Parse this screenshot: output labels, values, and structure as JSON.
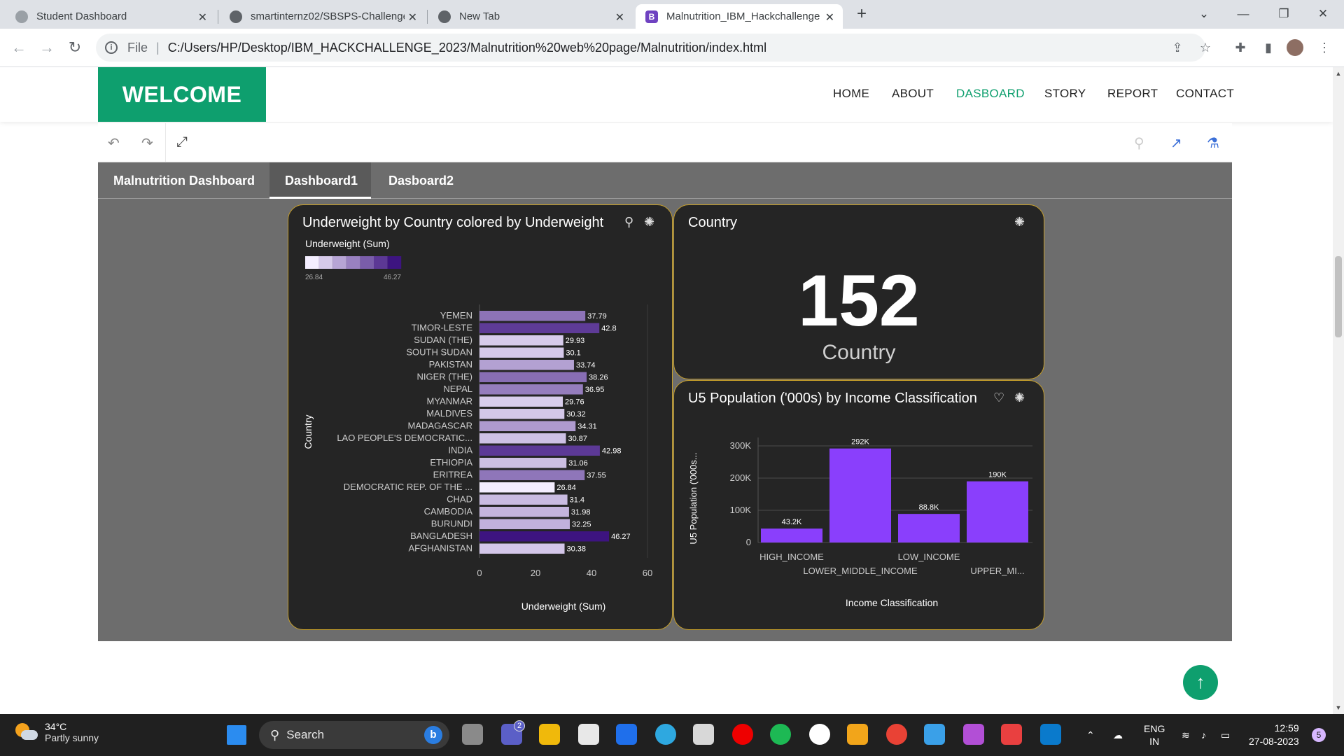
{
  "browser": {
    "tabs": [
      {
        "title": "Student Dashboard",
        "favicon": "globe-icon",
        "color": "#9aa0a6"
      },
      {
        "title": "smartinternz02/SBSPS-Challenge",
        "favicon": "github-icon",
        "color": "#5f6368"
      },
      {
        "title": "New Tab",
        "favicon": "chrome-icon",
        "color": "#5f6368"
      },
      {
        "title": "Malnutrition_IBM_Hackchallenge",
        "favicon": "bootstrap-icon",
        "color": "#6f42c1"
      }
    ],
    "address": {
      "scheme_label": "File",
      "url": "C:/Users/HP/Desktop/IBM_HACKCHALLENGE_2023/Malnutrition%20web%20page/Malnutrition/index.html"
    }
  },
  "site": {
    "brand": "WELCOME",
    "brand_color": "#0e9f6e",
    "nav": [
      "HOME",
      "ABOUT",
      "DASBOARD",
      "STORY",
      "REPORT",
      "CONTACT"
    ],
    "nav_active_index": 2
  },
  "dashboard": {
    "tabs": [
      "Malnutrition Dashboard",
      "Dashboard1",
      "Dasboard2"
    ],
    "active_tab_index": 1
  },
  "cards": {
    "underweight": {
      "title": "Underweight by Country colored by Underweight",
      "legend_title": "Underweight (Sum)",
      "legend_min": "26.84",
      "legend_max": "46.27"
    },
    "country_kpi": {
      "title": "Country",
      "value": "152",
      "label": "Country"
    },
    "population": {
      "title": "U5 Population ('000s) by Income Classification"
    }
  },
  "chart_data": [
    {
      "type": "bar",
      "orientation": "horizontal",
      "title": "Underweight by Country colored by Underweight",
      "xlabel": "Underweight (Sum)",
      "ylabel": "Country",
      "xlim": [
        0,
        60
      ],
      "xticks": [
        "0",
        "20",
        "40",
        "60"
      ],
      "color_scale": [
        "#f4eeff",
        "#3d1480"
      ],
      "categories": [
        "YEMEN",
        "TIMOR-LESTE",
        "SUDAN (THE)",
        "SOUTH SUDAN",
        "PAKISTAN",
        "NIGER (THE)",
        "NEPAL",
        "MYANMAR",
        "MALDIVES",
        "MADAGASCAR",
        "LAO PEOPLE'S DEMOCRATIC...",
        "INDIA",
        "ETHIOPIA",
        "ERITREA",
        "DEMOCRATIC REP. OF THE ...",
        "CHAD",
        "CAMBODIA",
        "BURUNDI",
        "BANGLADESH",
        "AFGHANISTAN"
      ],
      "values": [
        37.79,
        42.8,
        29.93,
        30.1,
        33.74,
        38.26,
        36.95,
        29.76,
        30.32,
        34.31,
        30.87,
        42.98,
        31.06,
        37.55,
        26.84,
        31.4,
        31.98,
        32.25,
        46.27,
        30.38
      ]
    },
    {
      "type": "bar",
      "title": "U5 Population ('000s) by Income Classification",
      "xlabel": "Income Classification",
      "ylabel": "U5 Population ('000s...",
      "ylim": [
        0,
        300000
      ],
      "yticks": [
        "0",
        "100K",
        "200K",
        "300K"
      ],
      "bar_color": "#8a3ffc",
      "categories": [
        "HIGH_INCOME",
        "LOWER_MIDDLE_INCOME",
        "LOW_INCOME",
        "UPPER_MI..."
      ],
      "values": [
        43200,
        292000,
        88800,
        190000
      ],
      "value_labels": [
        "43.2K",
        "292K",
        "88.8K",
        "190K"
      ]
    }
  ],
  "taskbar": {
    "weather_temp": "34°C",
    "weather_desc": "Partly sunny",
    "search_placeholder": "Search",
    "lang_line1": "ENG",
    "lang_line2": "IN",
    "time": "12:59",
    "date": "27-08-2023",
    "notification_count": "5",
    "teams_badge": "2"
  }
}
